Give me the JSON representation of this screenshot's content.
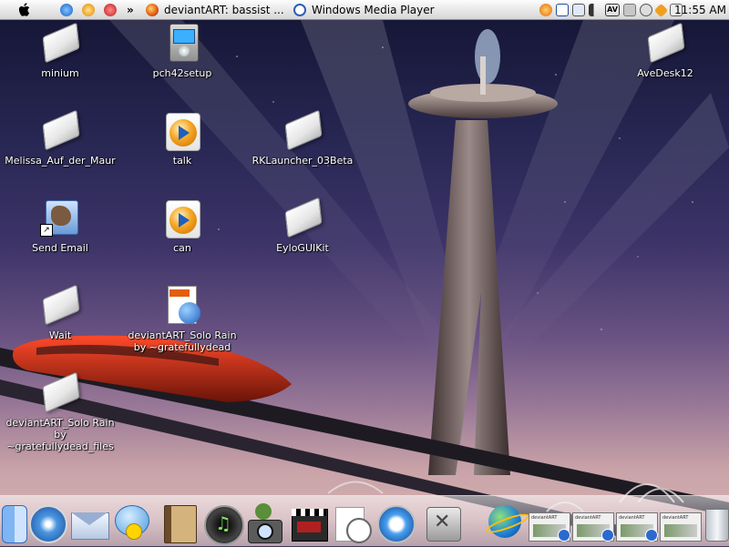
{
  "menubar": {
    "apple_icon": "apple-icon",
    "chevron": "»",
    "task_firefox": "deviantART: bassist ...",
    "task_wmp": "Windows Media Player",
    "clock": "11:55 AM",
    "av_badge": "AV"
  },
  "desktop": {
    "icons": [
      {
        "label": "minium",
        "icon": "blank-document-icon"
      },
      {
        "label": "pch42setup",
        "icon": "installer-icon"
      },
      {
        "label": "AveDesk12",
        "icon": "blank-document-icon"
      },
      {
        "label": "Melissa_Auf_der_Maur",
        "icon": "blank-document-icon"
      },
      {
        "label": "talk",
        "icon": "media-player-icon"
      },
      {
        "label": "RKLauncher_03Beta",
        "icon": "blank-document-icon"
      },
      {
        "label": "Send Email",
        "icon": "mail-shortcut-icon"
      },
      {
        "label": "can",
        "icon": "media-player-icon"
      },
      {
        "label": "EyloGUIKit",
        "icon": "blank-document-icon"
      },
      {
        "label": "Wait",
        "icon": "blank-document-icon"
      },
      {
        "label": "deviantART_Solo Rain\nby ~gratefullydead",
        "icon": "html-document-icon"
      },
      {
        "label": "deviantART_Solo Rain\nby ~gratefullydead_files",
        "icon": "blank-document-icon"
      }
    ]
  },
  "dock": {
    "items": [
      "finder-icon",
      "safari-icon",
      "mail-icon",
      "ichat-icon",
      "address-book-icon",
      "itunes-icon",
      "iphoto-icon",
      "imovie-icon",
      "ical-icon",
      "quicktime-icon",
      "system-preferences-icon",
      "internet-globe-icon",
      "window-thumbnail-icon",
      "window-thumbnail-icon",
      "window-thumbnail-icon",
      "trash-icon"
    ],
    "thumb_text": "deviantART"
  }
}
